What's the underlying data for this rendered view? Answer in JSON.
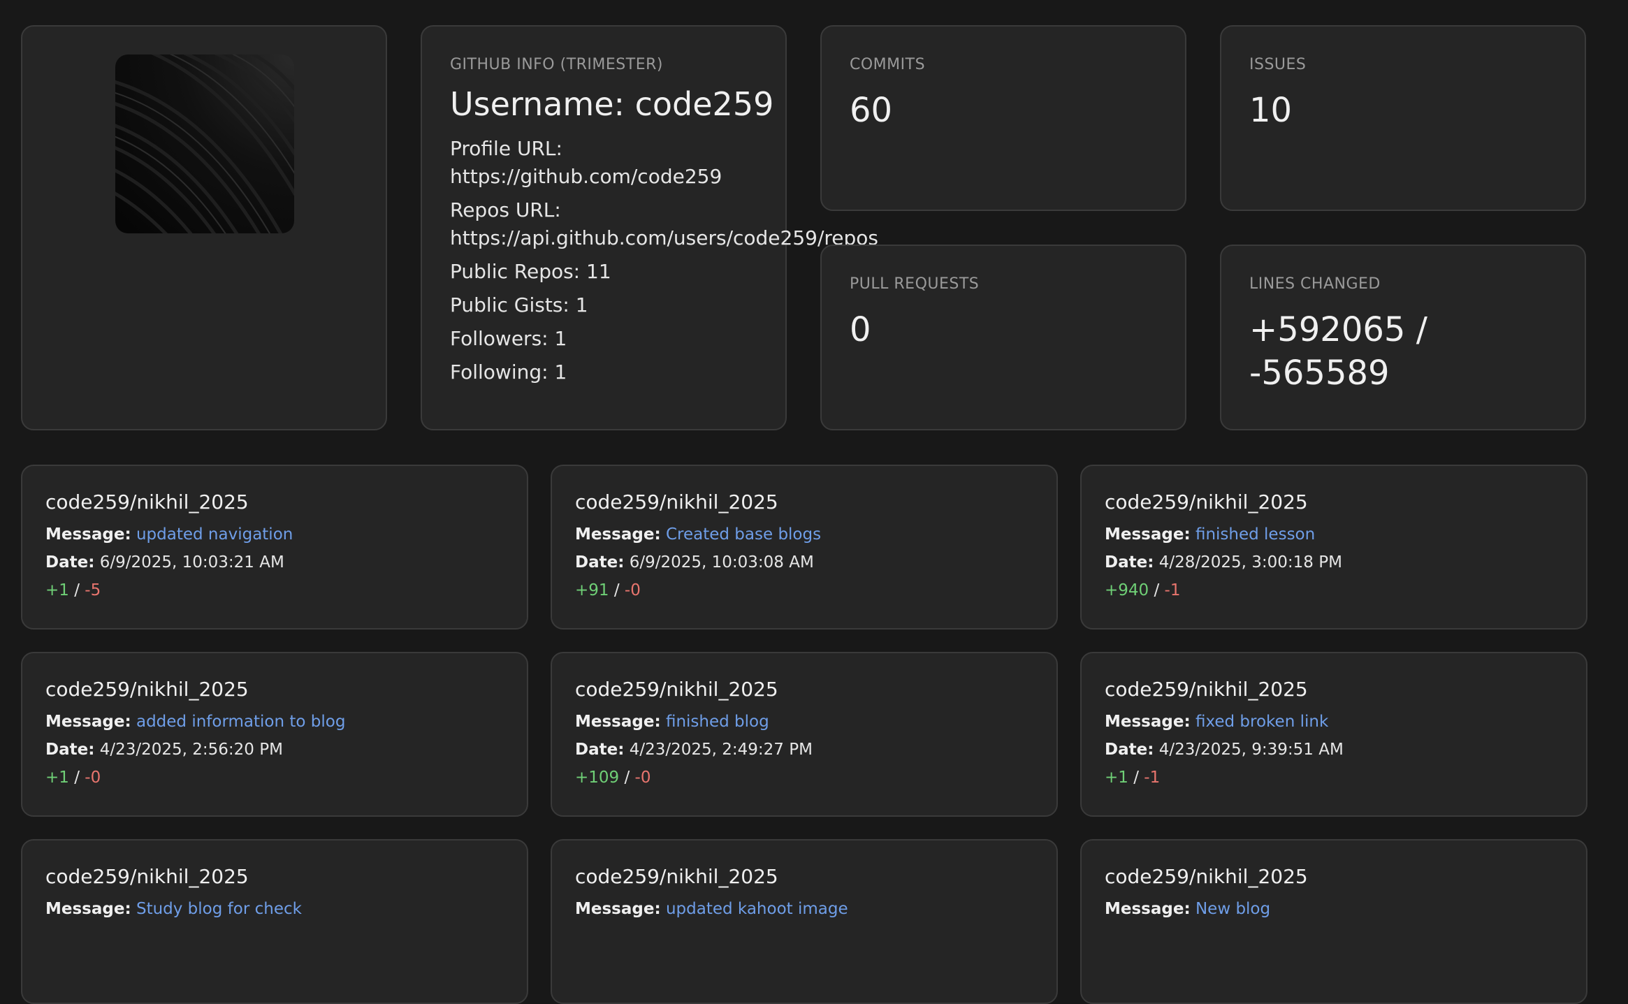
{
  "profile": {
    "section_label": "GITHUB INFO (TRIMESTER)",
    "username": "Username: code259",
    "profile_url_label": "Profile URL:",
    "profile_url": "https://github.com/code259",
    "repos_url_label": "Repos URL:",
    "repos_url": "https://api.github.com/users/code259/repos",
    "public_repos": "Public Repos: 11",
    "public_gists": "Public Gists: 1",
    "followers": "Followers: 1",
    "following": "Following: 1"
  },
  "stats": {
    "commits": {
      "label": "COMMITS",
      "value": "60"
    },
    "issues": {
      "label": "ISSUES",
      "value": "10"
    },
    "pull_requests": {
      "label": "PULL REQUESTS",
      "value": "0"
    },
    "lines_changed": {
      "label": "LINES CHANGED",
      "value_line1": "+592065 /",
      "value_line2": "-565589"
    }
  },
  "labels": {
    "message": "Message:",
    "date": "Date:",
    "sep": "/"
  },
  "commits": [
    {
      "repo": "code259/nikhil_2025",
      "message": "updated navigation",
      "date": "6/9/2025, 10:03:21 AM",
      "additions": "+1",
      "deletions": "-5"
    },
    {
      "repo": "code259/nikhil_2025",
      "message": "Created base blogs",
      "date": "6/9/2025, 10:03:08 AM",
      "additions": "+91",
      "deletions": "-0"
    },
    {
      "repo": "code259/nikhil_2025",
      "message": "finished lesson",
      "date": "4/28/2025, 3:00:18 PM",
      "additions": "+940",
      "deletions": "-1"
    },
    {
      "repo": "code259/nikhil_2025",
      "message": "added information to blog",
      "date": "4/23/2025, 2:56:20 PM",
      "additions": "+1",
      "deletions": "-0"
    },
    {
      "repo": "code259/nikhil_2025",
      "message": "finished blog",
      "date": "4/23/2025, 2:49:27 PM",
      "additions": "+109",
      "deletions": "-0"
    },
    {
      "repo": "code259/nikhil_2025",
      "message": "fixed broken link",
      "date": "4/23/2025, 9:39:51 AM",
      "additions": "+1",
      "deletions": "-1"
    },
    {
      "repo": "code259/nikhil_2025",
      "message": "Study blog for check",
      "date": "",
      "additions": "",
      "deletions": ""
    },
    {
      "repo": "code259/nikhil_2025",
      "message": "updated kahoot image",
      "date": "",
      "additions": "",
      "deletions": ""
    },
    {
      "repo": "code259/nikhil_2025",
      "message": "New blog",
      "date": "",
      "additions": "",
      "deletions": ""
    }
  ]
}
